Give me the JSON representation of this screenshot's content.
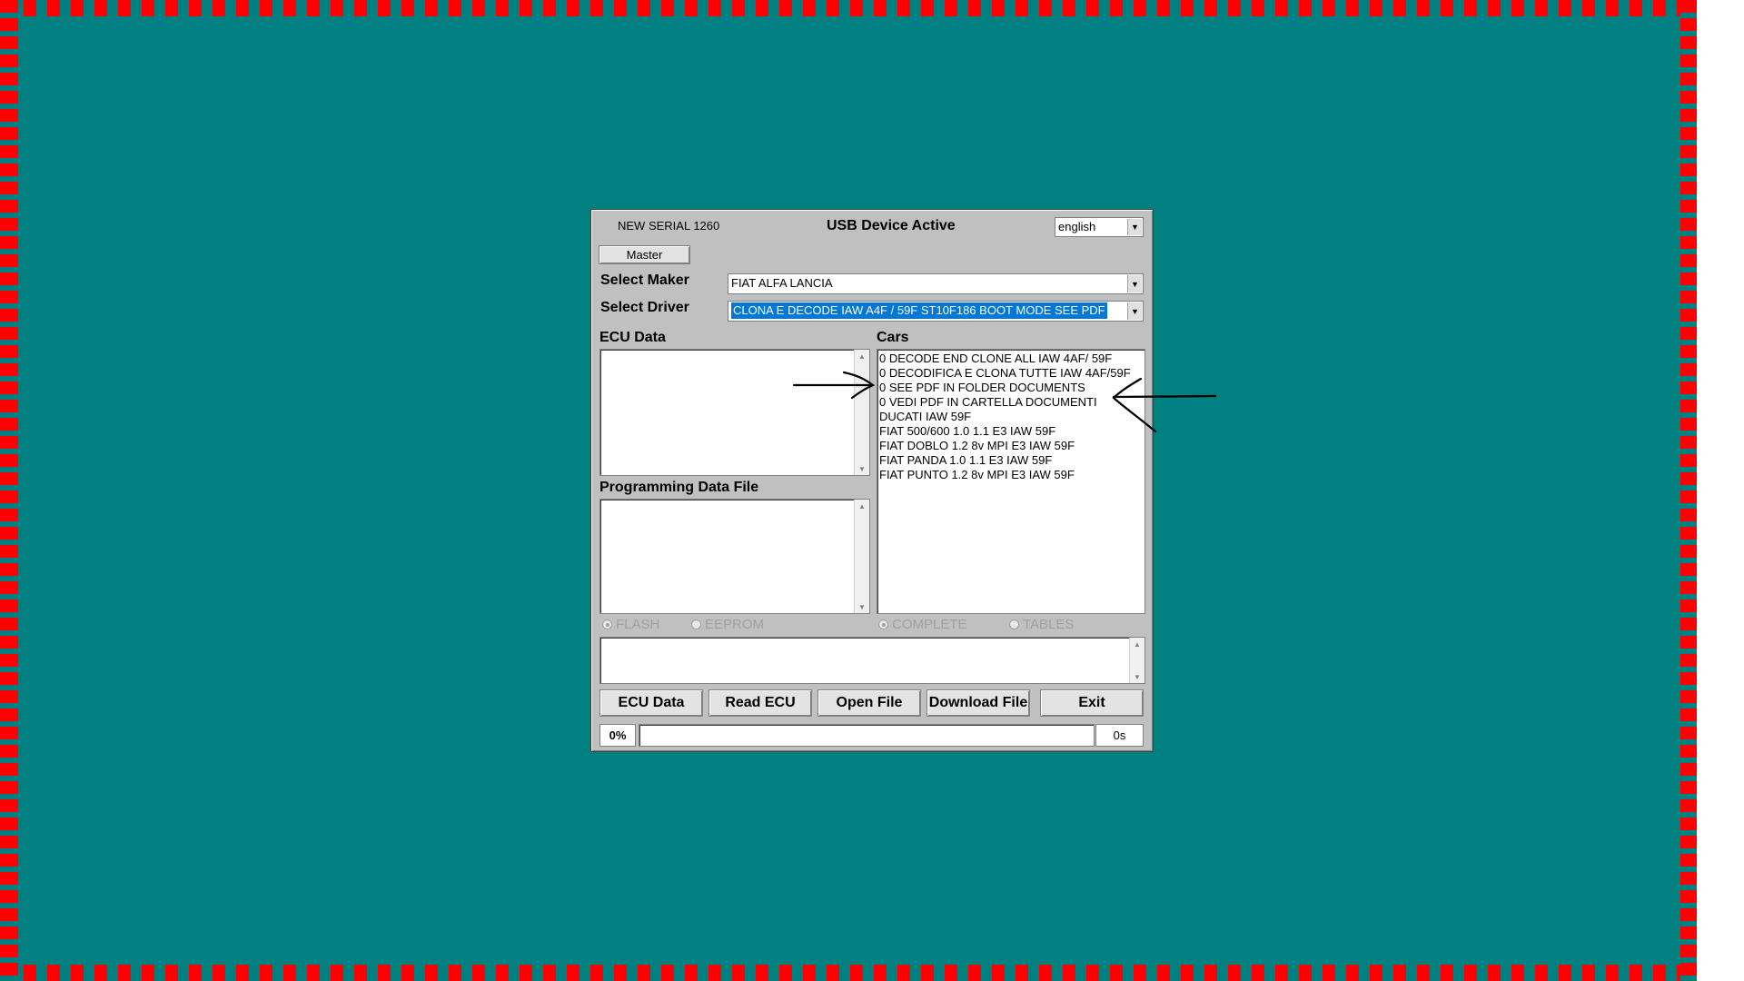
{
  "window": {
    "serial_label": "NEW SERIAL 1260",
    "status_label": "USB Device Active",
    "language": "english",
    "master_button": "Master"
  },
  "maker": {
    "label": "Select Maker",
    "value": "FIAT ALFA LANCIA"
  },
  "driver": {
    "label": "Select Driver",
    "value": "CLONA E DECODE IAW A4F / 59F ST10F186 BOOT MODE  SEE PDF"
  },
  "ecu_data": {
    "label": "ECU Data"
  },
  "programming": {
    "label": "Programming Data File"
  },
  "cars": {
    "label": "Cars",
    "items": [
      "0 DECODE END CLONE ALL IAW 4AF/ 59F",
      "0 DECODIFICA E CLONA TUTTE IAW 4AF/59F",
      "0 SEE PDF IN FOLDER DOCUMENTS",
      "0 VEDI PDF IN CARTELLA DOCUMENTI",
      "DUCATI IAW 59F",
      "FIAT 500/600 1.0 1.1 E3 IAW 59F",
      "FIAT DOBLO 1.2 8v MPI E3 IAW 59F",
      "FIAT PANDA 1.0 1.1 E3 IAW 59F",
      "FIAT PUNTO 1.2 8v MPI E3 IAW 59F"
    ]
  },
  "options": {
    "flash": "FLASH",
    "eeprom": "EEPROM",
    "complete": "COMPLETE",
    "tables": "TABLES"
  },
  "buttons": {
    "ecu_data": "ECU Data",
    "read_ecu": "Read ECU",
    "open_file": "Open File",
    "download_file": "Download File",
    "exit": "Exit"
  },
  "status": {
    "progress_text": "0%",
    "progress": 0,
    "time": "0s"
  },
  "colors": {
    "background": "#008080",
    "border_dash": "#ff0000",
    "selection": "#0078d7"
  }
}
